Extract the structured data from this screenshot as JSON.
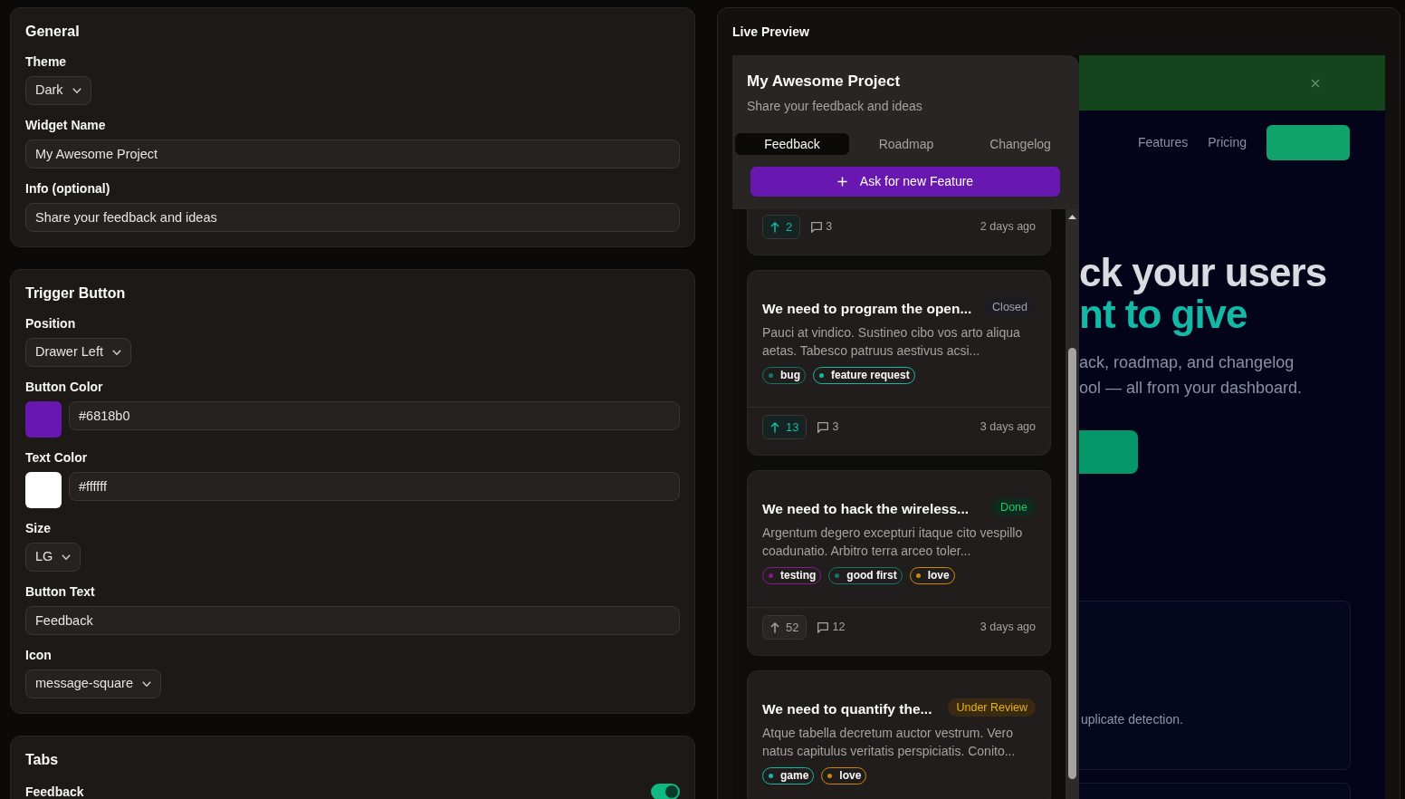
{
  "settings": [
    {
      "title": "General",
      "fields": [
        {
          "kind": "select",
          "label": "Theme",
          "value": "Dark"
        },
        {
          "kind": "text",
          "label": "Widget Name",
          "value": "My Awesome Project"
        },
        {
          "kind": "text",
          "label": "Info (optional)",
          "value": "Share your feedback and ideas"
        }
      ]
    },
    {
      "title": "Trigger Button",
      "fields": [
        {
          "kind": "select",
          "label": "Position",
          "value": "Drawer Left"
        },
        {
          "kind": "color",
          "label": "Button Color",
          "value": "#6818b0",
          "color": "#6818b0"
        },
        {
          "kind": "color",
          "label": "Text Color",
          "value": "#ffffff",
          "color": "#ffffff"
        },
        {
          "kind": "select",
          "label": "Size",
          "value": "LG"
        },
        {
          "kind": "text",
          "label": "Button Text",
          "value": "Feedback"
        },
        {
          "kind": "select",
          "label": "Icon",
          "value": "message-square"
        }
      ]
    },
    {
      "title": "Tabs",
      "fields": [
        {
          "kind": "toggle",
          "label": "Feedback",
          "on": true
        }
      ]
    }
  ],
  "live_preview": {
    "title": "Live Preview",
    "backdrop": {
      "nav_links": [
        "Features",
        "Pricing"
      ],
      "heading": [
        "ck your users",
        "nt to give"
      ],
      "subtitle": [
        "ack, roadmap, and changelog",
        "ool — all from your dashboard."
      ],
      "feature_text": "uplicate detection."
    },
    "widget": {
      "title": "My Awesome Project",
      "subtitle": "Share your feedback and ideas",
      "tabs": [
        {
          "label": "Feedback",
          "selected": true
        },
        {
          "label": "Roadmap",
          "selected": false
        },
        {
          "label": "Changelog",
          "selected": false
        }
      ],
      "action_button": "Ask for new Feature",
      "posts": [
        {
          "votes": "2",
          "voted": true,
          "comments": "3",
          "time": "2 days ago"
        },
        {
          "title": "We need to program the open...",
          "status": {
            "label": "Closed",
            "kind": "closed"
          },
          "description": "Pauci at vindico. Sustineo cibo vos arto aliqua aetas. Tabesco patruus aestivus acsi...",
          "tags": [
            {
              "label": "bug",
              "color": "#0f766e"
            },
            {
              "label": "feature request",
              "color": "#14b8a6"
            }
          ],
          "votes": "13",
          "voted": true,
          "comments": "3",
          "time": "3 days ago"
        },
        {
          "title": "We need to hack the wireless...",
          "status": {
            "label": "Done",
            "kind": "done"
          },
          "description": "Argentum degero excepturi itaque cito vespillo coadunatio. Arbitro terra arceo toler...",
          "tags": [
            {
              "label": "testing",
              "color": "#86198f"
            },
            {
              "label": "good first",
              "color": "#0f766e"
            },
            {
              "label": "love",
              "color": "#ca8a04"
            }
          ],
          "votes": "52",
          "voted": false,
          "comments": "12",
          "time": "3 days ago"
        },
        {
          "title": "We need to quantify the...",
          "status": {
            "label": "Under Review",
            "kind": "under_review"
          },
          "description": "Atque tabella decretum auctor vestrum. Vero natus capitulus veritatis perspiciatis. Conito...",
          "tags": [
            {
              "label": "game",
              "color": "#14b8a6"
            },
            {
              "label": "love",
              "color": "#ca8a04"
            }
          ]
        }
      ]
    }
  }
}
